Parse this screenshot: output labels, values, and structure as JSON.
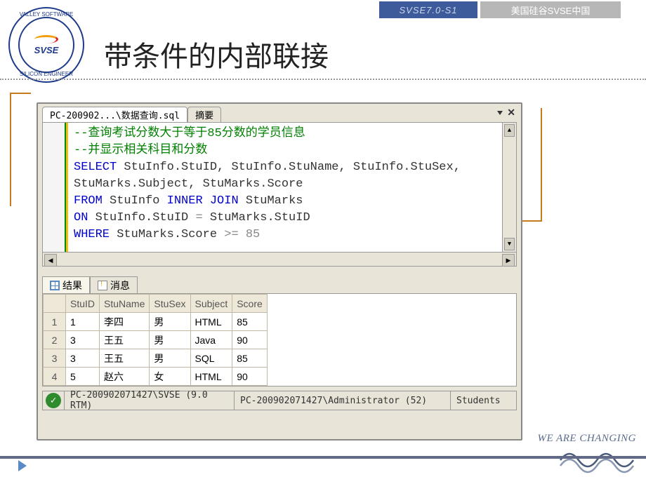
{
  "header": {
    "version": "SVSE7.0-S1",
    "brand": "美国硅谷SVSE中国"
  },
  "logo": {
    "abbr": "SVSE",
    "ring_top": "VALLEY  SOFTWARE",
    "ring_bottom": "SILICON ENGINEER"
  },
  "title": "带条件的内部联接",
  "sql_window": {
    "tabs": {
      "file": "PC-200902...\\数据查询.sql",
      "summary": "摘要"
    },
    "code": {
      "c1": "--查询考试分数大于等于85分数的学员信息",
      "c2": "--并显示相关科目和分数",
      "l1_kw": "SELECT",
      "l1_rest": " StuInfo.StuID, StuInfo.StuName, StuInfo.StuSex,",
      "l2": "StuMarks.Subject, StuMarks.Score",
      "l3_kw1": "FROM",
      "l3_mid": " StuInfo ",
      "l3_kw2": "INNER JOIN",
      "l3_end": " StuMarks",
      "l4_kw": "ON",
      "l4_rest": " StuInfo.StuID ",
      "l4_eq": "=",
      "l4_rest2": " StuMarks.StuID",
      "l5_kw": "WHERE",
      "l5_rest": " StuMarks.Score ",
      "l5_op": ">= 85"
    },
    "result_tabs": {
      "results": "结果",
      "messages": "消息"
    },
    "grid": {
      "headers": [
        "StuID",
        "StuName",
        "StuSex",
        "Subject",
        "Score"
      ],
      "rows": [
        {
          "n": "1",
          "c": [
            "1",
            "李四",
            "男",
            "HTML",
            "85"
          ]
        },
        {
          "n": "2",
          "c": [
            "3",
            "王五",
            "男",
            "Java",
            "90"
          ]
        },
        {
          "n": "3",
          "c": [
            "3",
            "王五",
            "男",
            "SQL",
            "85"
          ]
        },
        {
          "n": "4",
          "c": [
            "5",
            "赵六",
            "女",
            "HTML",
            "90"
          ]
        }
      ]
    },
    "status": {
      "server": "PC-200902071427\\SVSE (9.0 RTM)",
      "user": "PC-200902071427\\Administrator (52)",
      "db": "Students",
      "ok": "✓"
    }
  },
  "footer": {
    "slogan": "WE ARE CHANGING"
  }
}
